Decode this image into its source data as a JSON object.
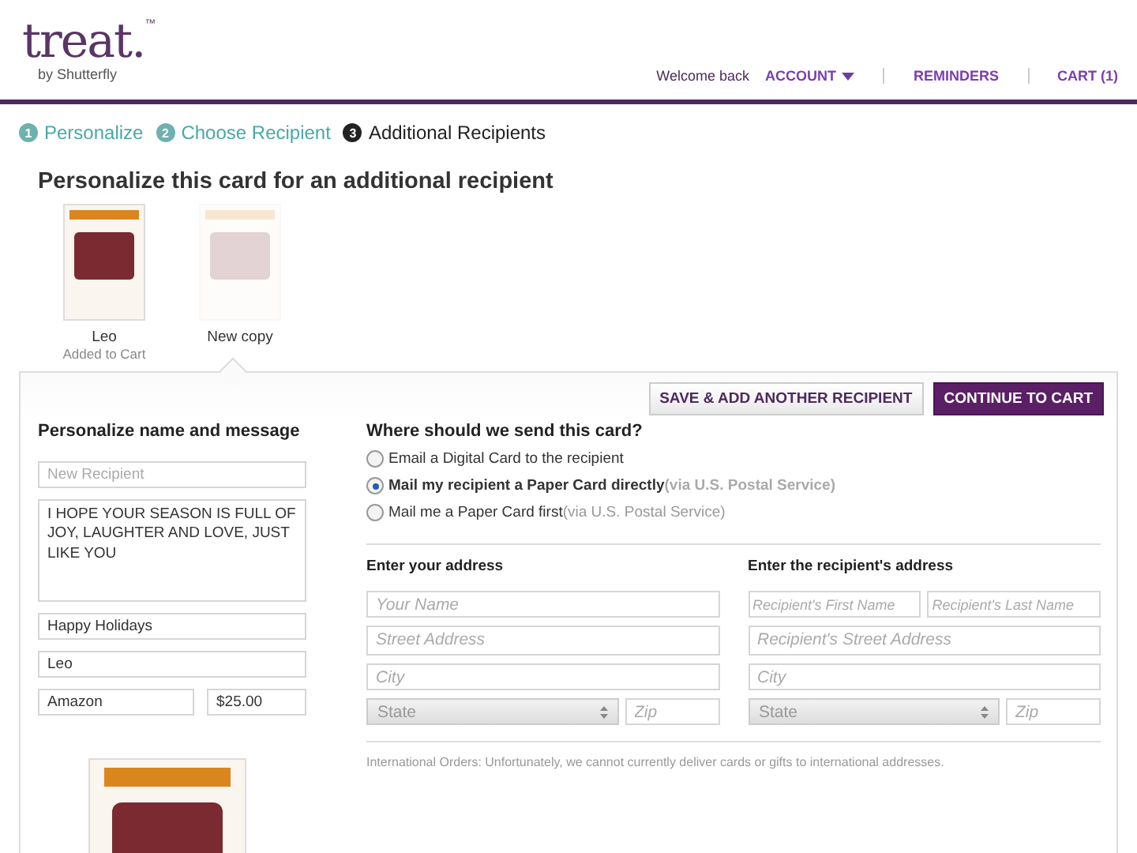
{
  "header": {
    "logo": "treat.",
    "logo_mark": "™",
    "logo_sub": "by Shutterfly",
    "welcome": "Welcome back",
    "nav": [
      {
        "label": "ACCOUNT",
        "dropdown": true
      },
      {
        "label": "REMINDERS",
        "dropdown": false
      },
      {
        "label": "CART (1)",
        "dropdown": false
      }
    ]
  },
  "steps": [
    {
      "number": "1",
      "label": "Personalize",
      "selected": false
    },
    {
      "number": "2",
      "label": "Choose Recipient",
      "selected": false
    },
    {
      "number": "3",
      "label": "Additional Recipients",
      "selected": true
    }
  ],
  "title": "Personalize this card for an additional recipient",
  "copies": [
    {
      "name": "Leo",
      "status": "Added to Cart",
      "selected": false
    },
    {
      "name": "New copy",
      "selected": true
    }
  ],
  "buttons": [
    {
      "label": "SAVE & ADD ANOTHER RECIPIENT",
      "kind": "secondary"
    },
    {
      "label": "CONTINUE TO CART",
      "kind": "primary"
    }
  ],
  "personalize": {
    "heading": "Personalize name and message",
    "name_placeholder": "New Recipient",
    "message": "I HOPE YOUR SEASON IS FULL OF JOY, LAUGHTER AND LOVE, JUST LIKE YOU",
    "greeting": "Happy Holidays",
    "signature": "Leo",
    "gift": "Amazon",
    "amount": "$25.00"
  },
  "delivery": {
    "heading": "Where should we send this card?",
    "options": [
      {
        "label": "Email a Digital Card to the recipient",
        "selected": false
      },
      {
        "label": "Mail my recipient a Paper Card directly",
        "note": "(via U.S. Postal Service)",
        "selected": true
      },
      {
        "label": "Mail me a Paper Card first",
        "note": "(via U.S. Postal Service)",
        "selected": false
      }
    ]
  },
  "your_address": {
    "heading": "Enter your address",
    "name_placeholder": "Your Name",
    "street_placeholder": "Street Address",
    "city_placeholder": "City",
    "state": "State",
    "zip_placeholder": "Zip"
  },
  "recipient_address": {
    "heading": "Enter the recipient's address",
    "first_name_placeholder": "Recipient's First Name",
    "last_name_placeholder": "Recipient's Last Name",
    "street_placeholder": "Recipient's Street Address",
    "city_placeholder": "City",
    "state": "State",
    "zip_placeholder": "Zip"
  },
  "notice": "International Orders: Unfortunately, we cannot currently deliver cards or gifts to international addresses."
}
